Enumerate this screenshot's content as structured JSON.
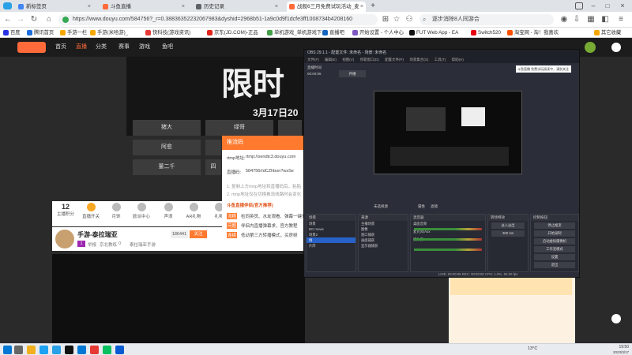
{
  "browser": {
    "tabs": [
      {
        "label": "新标签页",
        "active": false
      },
      {
        "label": "斗鱼直播",
        "active": false
      },
      {
        "label": "历史记录",
        "active": false
      },
      {
        "label": "战舰6三月免费试玩活动_麦",
        "active": true
      }
    ],
    "new_tab_label": "+",
    "url": "https://www.douyu.com/584756?_r=0.38836352232067983&dyshid=2968b51-1a9c0d9f1dcfe3ff1008734b4208160",
    "search_text": "逐步消除8人同游合"
  },
  "bookmarks": [
    {
      "label": "百度"
    },
    {
      "label": "腾讯首页"
    },
    {
      "label": "手游一栏"
    },
    {
      "label": "手游(米哈游)_"
    },
    {
      "label": "快科技(游戏资讯)"
    },
    {
      "label": "京东(JD.COM)-正品"
    },
    {
      "label": "单机游戏_单机游戏下"
    },
    {
      "label": "直播吧"
    },
    {
      "label": "开始设置 - 个人中心"
    },
    {
      "label": "FUT Web App - EA"
    },
    {
      "label": "Switch520"
    },
    {
      "label": "淘宝网 - 淘！我喜欢"
    },
    {
      "label": "其它收藏"
    }
  ],
  "site": {
    "nav": [
      "首页",
      "直播",
      "分类",
      "赛事",
      "游戏",
      "鱼吧"
    ],
    "active_nav": "直播",
    "banner_title": "限时",
    "banner_date": "3月17日20",
    "tags": [
      "猪大",
      "绿哥",
      "阿愈",
      "",
      "董二千",
      "四"
    ],
    "gifts": [
      {
        "label": "主播积分",
        "value": "12"
      },
      {
        "label": "直播开关"
      },
      {
        "label": "月饰"
      },
      {
        "label": "欧派中心"
      },
      {
        "label": "声浪"
      },
      {
        "label": "AR礼物"
      },
      {
        "label": "礼物"
      }
    ],
    "streamer": {
      "name": "手游-泰拉瑞亚",
      "level": "1",
      "follow_count": "186441",
      "follow_button": "关注",
      "meta1": "举报",
      "meta2": "京北教练",
      "meta3": "0",
      "meta4": "泰拉瑞亚手游"
    }
  },
  "dialog": {
    "title": "推流码",
    "rtmp_label": "rtmp地址:",
    "rtmp_value": "rtmp://sendtc3.douyu.com",
    "code_label": "直播码:",
    "code_value": "584756rIdCZhbon?wsSe",
    "hint1": "1. 复制上方rtmp地址和直播码后，粘贴",
    "hint2": "2. rtmp地址仅在切换推流线路时会变化",
    "banner": "斗鱼直播伴侣(官方推荐)",
    "warn1_label": "流程",
    "warn1_text": "检同英员、水友观看、弹幕一键开",
    "warn2_label": "问题",
    "warn2_text": "伴侣内直播弹幕求，官方教程",
    "warn3_label": "连续",
    "warn3_text": "低动第三方转播模式，买房频"
  },
  "obs": {
    "title": "OBS 29.1.1 - 配置文件: 未命名 - 场景: 未命名",
    "menu": [
      "文件(F)",
      "编辑(E)",
      "视图(V)",
      "停靠窗口(D)",
      "配置文件(P)",
      "场景集合(S)",
      "工具(T)",
      "帮助(H)"
    ],
    "status_label": "开播",
    "status_left": "直播时间",
    "status_time": "00:00:06",
    "inner_status": "斗鱼直播 免费试玩阅读中，请别关注",
    "properties": "属性",
    "filters": "滤镜",
    "scenes_header": "场景",
    "scenes": [
      "场景",
      "BG movie",
      "场景2",
      "场",
      "片库"
    ],
    "selected_scene": "场",
    "sources_header": "来源",
    "sources": [
      "主播场景",
      "图像",
      "窗口捕获",
      "画面捕获",
      "显示器捕获"
    ],
    "mixer_header": "混音器",
    "mixer": [
      {
        "label": "桌面音频",
        "db": "0.0 dB"
      },
      {
        "label": "麦克风/Aux",
        "db": "0.0 dB"
      },
      {
        "label": "媒体源",
        "db": "0.0 dB"
      }
    ],
    "transitions_header": "转场特效",
    "transition_value": "淡入淡出",
    "transition_duration": "300 ms",
    "controls_header": "控制按钮",
    "controls": [
      "停止推流",
      "开始录制",
      "启动虚拟摄像机",
      "工作室模式",
      "设置",
      "退出"
    ],
    "footer": "LIVE: 00:00:06  REC: 00:00:00  CPU: 1.0%, 60.00 fps"
  },
  "taskbar": {
    "time": "19:50",
    "date": "2023/3/17",
    "weather": "13°C"
  }
}
